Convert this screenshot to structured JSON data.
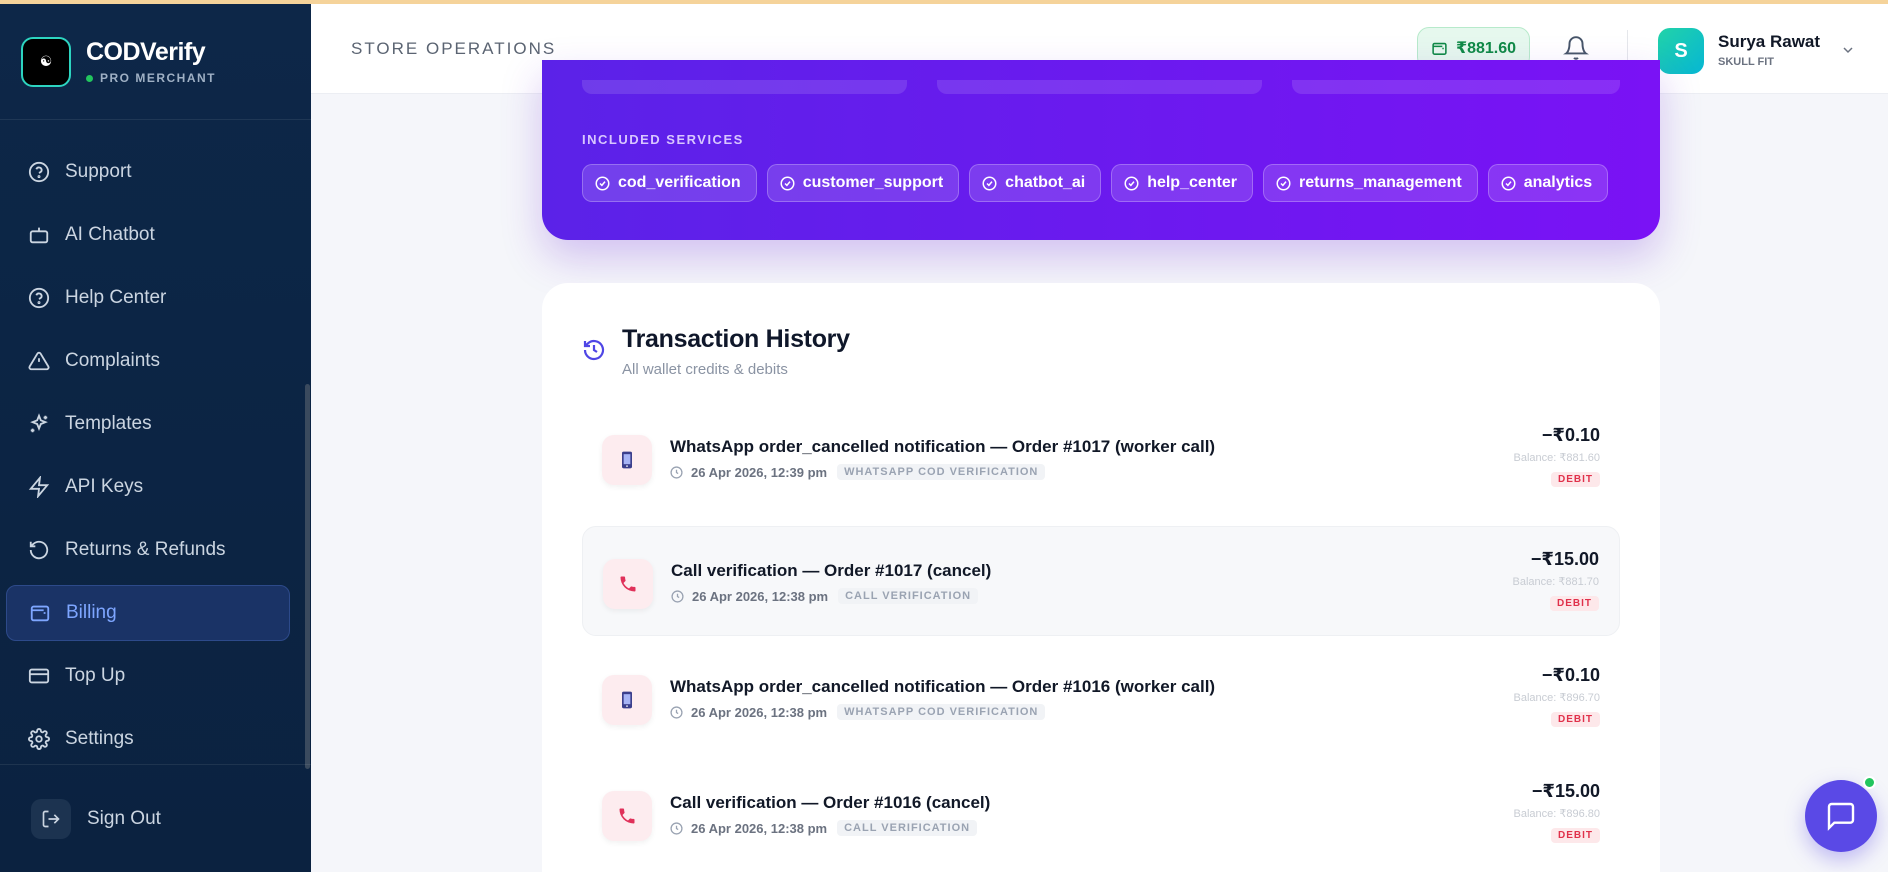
{
  "brand": {
    "name": "CODVerify",
    "tier": "PRO MERCHANT",
    "logo_text": "☯"
  },
  "sidebar": {
    "items": [
      {
        "label": "Support",
        "icon": "help-circle-icon"
      },
      {
        "label": "AI Chatbot",
        "icon": "bot-icon"
      },
      {
        "label": "Help Center",
        "icon": "help-circle-icon"
      },
      {
        "label": "Complaints",
        "icon": "alert-triangle-icon"
      },
      {
        "label": "Templates",
        "icon": "sparkles-icon"
      },
      {
        "label": "API Keys",
        "icon": "lightning-icon"
      },
      {
        "label": "Returns & Refunds",
        "icon": "rotate-ccw-icon"
      },
      {
        "label": "Billing",
        "icon": "wallet-icon",
        "active": true
      },
      {
        "label": "Top Up",
        "icon": "credit-card-icon"
      },
      {
        "label": "Settings",
        "icon": "gear-icon"
      }
    ],
    "sign_out": "Sign Out"
  },
  "header": {
    "title": "STORE OPERATIONS",
    "wallet_balance": "₹881.60",
    "user_name": "Surya Rawat",
    "user_store": "SKULL FIT",
    "avatar_initial": "S"
  },
  "plan": {
    "services_label": "INCLUDED SERVICES",
    "services": [
      "cod_verification",
      "customer_support",
      "chatbot_ai",
      "help_center",
      "returns_management",
      "analytics"
    ]
  },
  "transactions": {
    "title": "Transaction History",
    "subtitle": "All wallet credits & debits",
    "rows": [
      {
        "icon": "phone-mobile-icon",
        "description": "WhatsApp order_cancelled notification — Order #1017 (worker call)",
        "time": "26 Apr 2026, 12:39 pm",
        "tag": "WHATSAPP COD VERIFICATION",
        "amount": "−₹0.10",
        "balance": "Balance: ₹881.60",
        "type": "DEBIT"
      },
      {
        "icon": "phone-call-icon",
        "description": "Call verification — Order #1017 (cancel)",
        "time": "26 Apr 2026, 12:38 pm",
        "tag": "CALL VERIFICATION",
        "amount": "−₹15.00",
        "balance": "Balance: ₹881.70",
        "type": "DEBIT"
      },
      {
        "icon": "phone-mobile-icon",
        "description": "WhatsApp order_cancelled notification — Order #1016 (worker call)",
        "time": "26 Apr 2026, 12:38 pm",
        "tag": "WHATSAPP COD VERIFICATION",
        "amount": "−₹0.10",
        "balance": "Balance: ₹896.70",
        "type": "DEBIT"
      },
      {
        "icon": "phone-call-icon",
        "description": "Call verification — Order #1016 (cancel)",
        "time": "26 Apr 2026, 12:38 pm",
        "tag": "CALL VERIFICATION",
        "amount": "−₹15.00",
        "balance": "Balance: ₹896.80",
        "type": "DEBIT"
      }
    ]
  },
  "colors": {
    "accent": "#6d28d9",
    "sidebar_bg": "#0d2748",
    "debit": "#e0314b",
    "wallet": "#0f8a46"
  }
}
